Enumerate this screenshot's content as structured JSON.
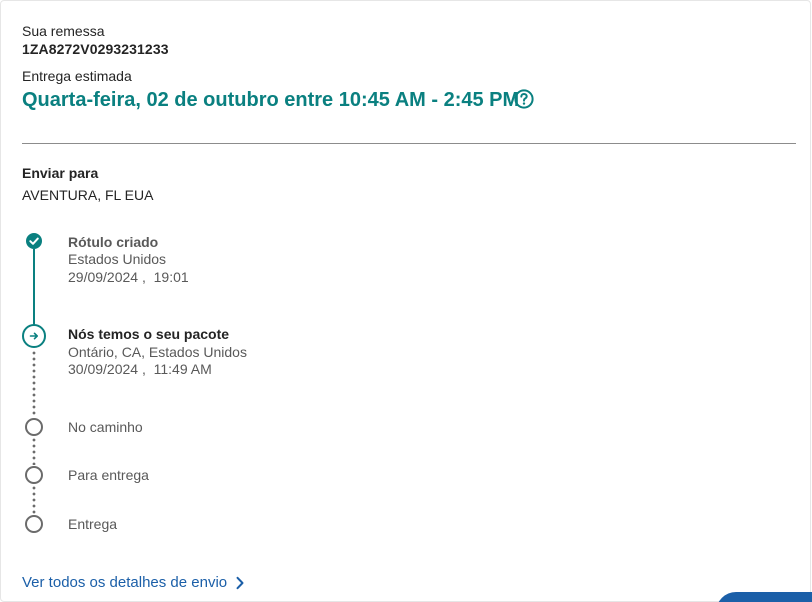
{
  "shipment": {
    "label": "Sua remessa",
    "tracking_number": "1ZA8272V0293231233",
    "estimated_label": "Entrega estimada",
    "estimated_delivery": "Quarta-feira, 02 de outubro entre 10:45 AM - 2:45 PM"
  },
  "ship_to": {
    "label": "Enviar para",
    "value": "AVENTURA, FL EUA"
  },
  "timeline": {
    "events": [
      {
        "title": "Rótulo criado",
        "location": "Estados Unidos",
        "datetime": "29/09/2024 ,  19:01",
        "status": "done"
      },
      {
        "title": "Nós temos o seu pacote",
        "location": "Ontário, CA, Estados Unidos",
        "datetime": "30/09/2024 ,  11:49 AM",
        "status": "current"
      }
    ],
    "pending": [
      "No caminho",
      "Para entrega",
      "Entrega"
    ]
  },
  "details_link": "Ver todos os detalhes de envio",
  "colors": {
    "accent_teal": "#0a8080",
    "link_blue": "#1b5fa8",
    "pending_gray": "#6b6b6b"
  },
  "icons": {
    "help": "question-circle-icon",
    "done": "check-circle-icon",
    "current": "arrow-right-circle-icon",
    "pending": "empty-circle-icon",
    "link": "chevron-right-icon"
  }
}
